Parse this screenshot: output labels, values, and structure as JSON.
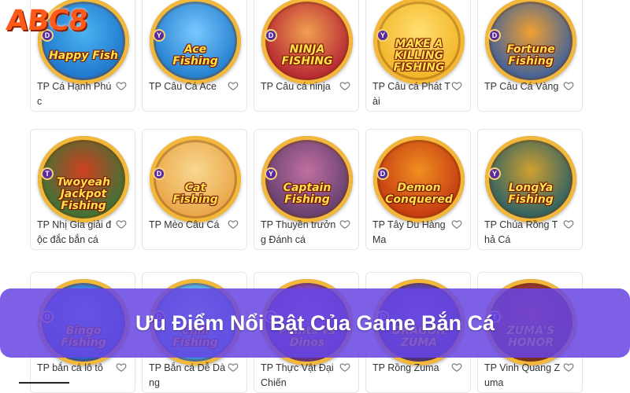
{
  "brand": {
    "logo_text": "ABC8"
  },
  "banner": {
    "text": "Ưu Điểm Nổi Bật Của Game Bắn Cá"
  },
  "games": [
    {
      "name": "TP Cá Hạnh Phúc",
      "art": "Happy Fish",
      "badge": "D",
      "colors": [
        "#1a6fc8",
        "#4bb4f0"
      ]
    },
    {
      "name": "TP Câu Cá Ace",
      "art": "Ace\nFishing",
      "badge": "Y",
      "colors": [
        "#1a76c9",
        "#79c8ff"
      ]
    },
    {
      "name": "TP Câu cá ninja",
      "art": "NINJA\nFISHING",
      "badge": "D",
      "colors": [
        "#b01830",
        "#f0a050"
      ]
    },
    {
      "name": "TP Câu cá Phát Tài",
      "art": "MAKE A\nKILLING\nFISHING",
      "badge": "Y",
      "colors": [
        "#f0b020",
        "#ffe070"
      ]
    },
    {
      "name": "TP Câu Cá Vàng",
      "art": "Fortune\nFishing",
      "badge": "D",
      "colors": [
        "#2a5aa8",
        "#f0a030"
      ]
    },
    {
      "name": "TP Nhị Gia giải độc đắc bắn cá",
      "art": "Twoyeah\nJackpot Fishing",
      "badge": "T",
      "colors": [
        "#2a7a3a",
        "#d04020"
      ]
    },
    {
      "name": "TP Mèo Câu Cá",
      "art": "Cat\nFishing",
      "badge": "D",
      "colors": [
        "#e8a040",
        "#f8d890"
      ]
    },
    {
      "name": "TP Thuyền trưởng Đánh cá",
      "art": "Captain\nFishing",
      "badge": "Y",
      "colors": [
        "#5a3a6a",
        "#c070a0"
      ]
    },
    {
      "name": "TP Tây Du Hàng Ma",
      "art": "Demon\nConquered",
      "badge": "D",
      "colors": [
        "#c03010",
        "#f09020"
      ]
    },
    {
      "name": "TP Chúa Rồng Thả Cá",
      "art": "LongYa\nFishing",
      "badge": "Y",
      "colors": [
        "#1a5a6a",
        "#d0a030"
      ]
    },
    {
      "name": "TP bắn cá lô tô",
      "art": "Bingo\nFishing",
      "badge": "D",
      "colors": [
        "#1a5ac8",
        "#60a8f0"
      ]
    },
    {
      "name": "TP Bắn cá Dễ Dàng",
      "art": "Chili\nFishing",
      "badge": "D",
      "colors": [
        "#2a8ad8",
        "#8ad0f8"
      ]
    },
    {
      "name": "TP Thực Vật Đại Chiến",
      "art": "Plants vs Dinos",
      "badge": "D",
      "colors": [
        "#5a2a9a",
        "#a060d0"
      ]
    },
    {
      "name": "TP Rồng Zuma",
      "art": "DRAGON ZUMA",
      "badge": "D",
      "colors": [
        "#3a2a8a",
        "#7a60d0"
      ]
    },
    {
      "name": "TP Vinh Quang Zuma",
      "art": "ZUMA'S\nHONOR",
      "badge": "T",
      "colors": [
        "#6a2a2a",
        "#c04040"
      ]
    }
  ]
}
